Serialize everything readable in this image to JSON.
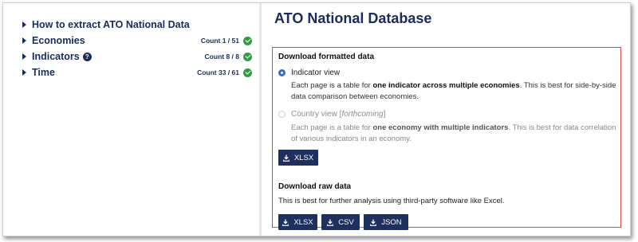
{
  "sidebar": {
    "items": [
      {
        "label": "How to extract ATO National Data"
      },
      {
        "label": "Economies",
        "count": "Count 1 / 51"
      },
      {
        "label": "Indicators",
        "help": "?",
        "count": "Count 8 / 8"
      },
      {
        "label": "Time",
        "count": "Count 33 / 61"
      }
    ]
  },
  "main": {
    "title": "ATO National Database",
    "formatted": {
      "heading": "Download formatted data",
      "indicator_view": {
        "label": "Indicator view",
        "desc_pre": "Each page is a table for ",
        "desc_bold": "one indicator across multiple economies",
        "desc_post": ". This is best for side-by-side data comparison between economies."
      },
      "country_view": {
        "label": "Country view [",
        "label_italic": "forthcoming",
        "label_end": "]",
        "desc_pre": "Each page is a table for ",
        "desc_bold": "one economy with multiple indicators",
        "desc_post": ". This is best for data correlation of various indicators in an economy."
      },
      "xlsx_button": "XLSX"
    },
    "raw": {
      "heading": "Download raw data",
      "desc": "This is best for further analysis using third-party software like Excel.",
      "buttons": [
        "XLSX",
        "CSV",
        "JSON"
      ]
    }
  },
  "colors": {
    "navy": "#1a2c5b",
    "check_green": "#2f9a47",
    "box_border_red": "#e2483f",
    "button_bg": "#1f2f5e"
  },
  "icons": {
    "nav": "caret-right-icon",
    "status": "check-circle-icon",
    "download": "download-icon",
    "help": "question-circle-icon"
  }
}
